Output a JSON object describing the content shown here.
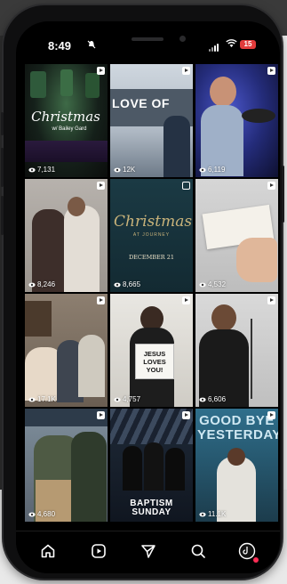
{
  "status_bar": {
    "time": "8:49",
    "battery": "15"
  },
  "colors": {
    "battery": "#e23b3b",
    "tab_icon": "#ffffff",
    "notification_dot": "#ff2d55"
  },
  "grid": {
    "tiles": [
      {
        "views": "7,131",
        "badge": "reel",
        "title": "Christmas",
        "subtitle": "w/ Bailey Gard"
      },
      {
        "views": "12K",
        "badge": "reel",
        "title": "LOVE OF"
      },
      {
        "views": "6,119",
        "badge": "reel"
      },
      {
        "views": "8,246",
        "badge": "reel"
      },
      {
        "views": "8,665",
        "badge": "carousel",
        "title": "Christmas",
        "subtitle": "AT JOURNEY",
        "date": "DECEMBER 21"
      },
      {
        "views": "4,532",
        "badge": "reel"
      },
      {
        "views": "17.1K",
        "badge": "reel"
      },
      {
        "views": "4,757",
        "badge": "reel",
        "sign": "JESUS LOVES YOU!"
      },
      {
        "views": "6,606",
        "badge": "reel"
      },
      {
        "views": "4,680",
        "badge": "reel"
      },
      {
        "views": "",
        "badge": "reel",
        "title": "BAPTISM SUNDAY"
      },
      {
        "views": "11.1K",
        "badge": "reel",
        "title": "GOOD BYE YESTERDAY"
      }
    ]
  },
  "tabbar": {
    "items": [
      "home-icon",
      "reels-icon",
      "send-icon",
      "search-icon",
      "profile-icon"
    ]
  }
}
